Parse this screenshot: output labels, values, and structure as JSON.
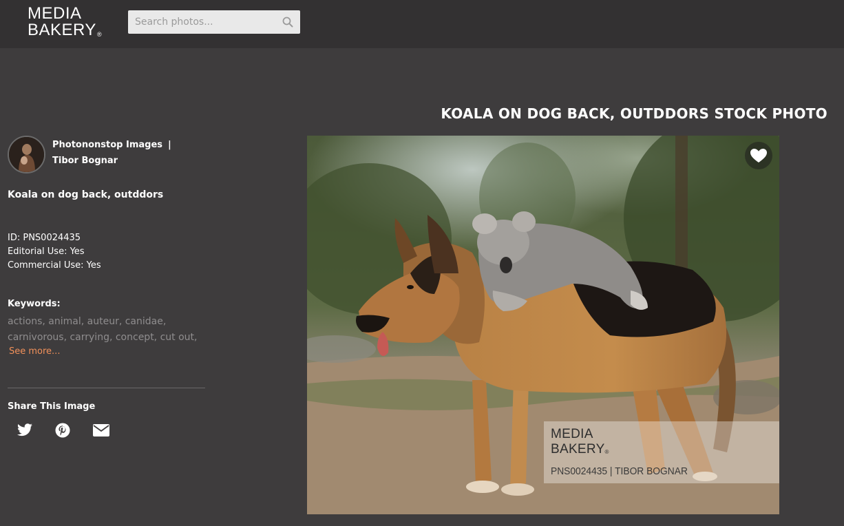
{
  "header": {
    "logo_line1": "MEDIA",
    "logo_line2": "BAKERY",
    "logo_reg": "®",
    "search_placeholder": "Search photos...",
    "search_icon": "search-icon"
  },
  "page_title": "KOALA ON DOG BACK, OUTDDORS STOCK PHOTO",
  "author": {
    "agency": "Photononstop Images",
    "separator": "|",
    "photographer": "Tibor Bognar"
  },
  "image_description": "Koala on dog back, outddors",
  "meta": {
    "id": "ID: PNS0024435",
    "editorial": "Editorial Use: Yes",
    "commercial": "Commercial Use: Yes"
  },
  "keywords": {
    "label": "Keywords:",
    "line1": "actions, animal, auteur, canidae,",
    "line2": "carnivorous, carrying, concept, cut out,",
    "see_more": "See more..."
  },
  "share": {
    "label": "Share This Image",
    "icons": [
      "twitter-icon",
      "pinterest-icon",
      "email-icon"
    ]
  },
  "watermark": {
    "line1": "MEDIA",
    "line2": "BAKERY",
    "reg": "®",
    "code": "PNS0024435 | TIBOR BOGNAR"
  },
  "colors": {
    "background": "#3e3c3d",
    "header": "#333132",
    "accent": "#f2915a",
    "keyword_text": "#8f8d8e"
  }
}
